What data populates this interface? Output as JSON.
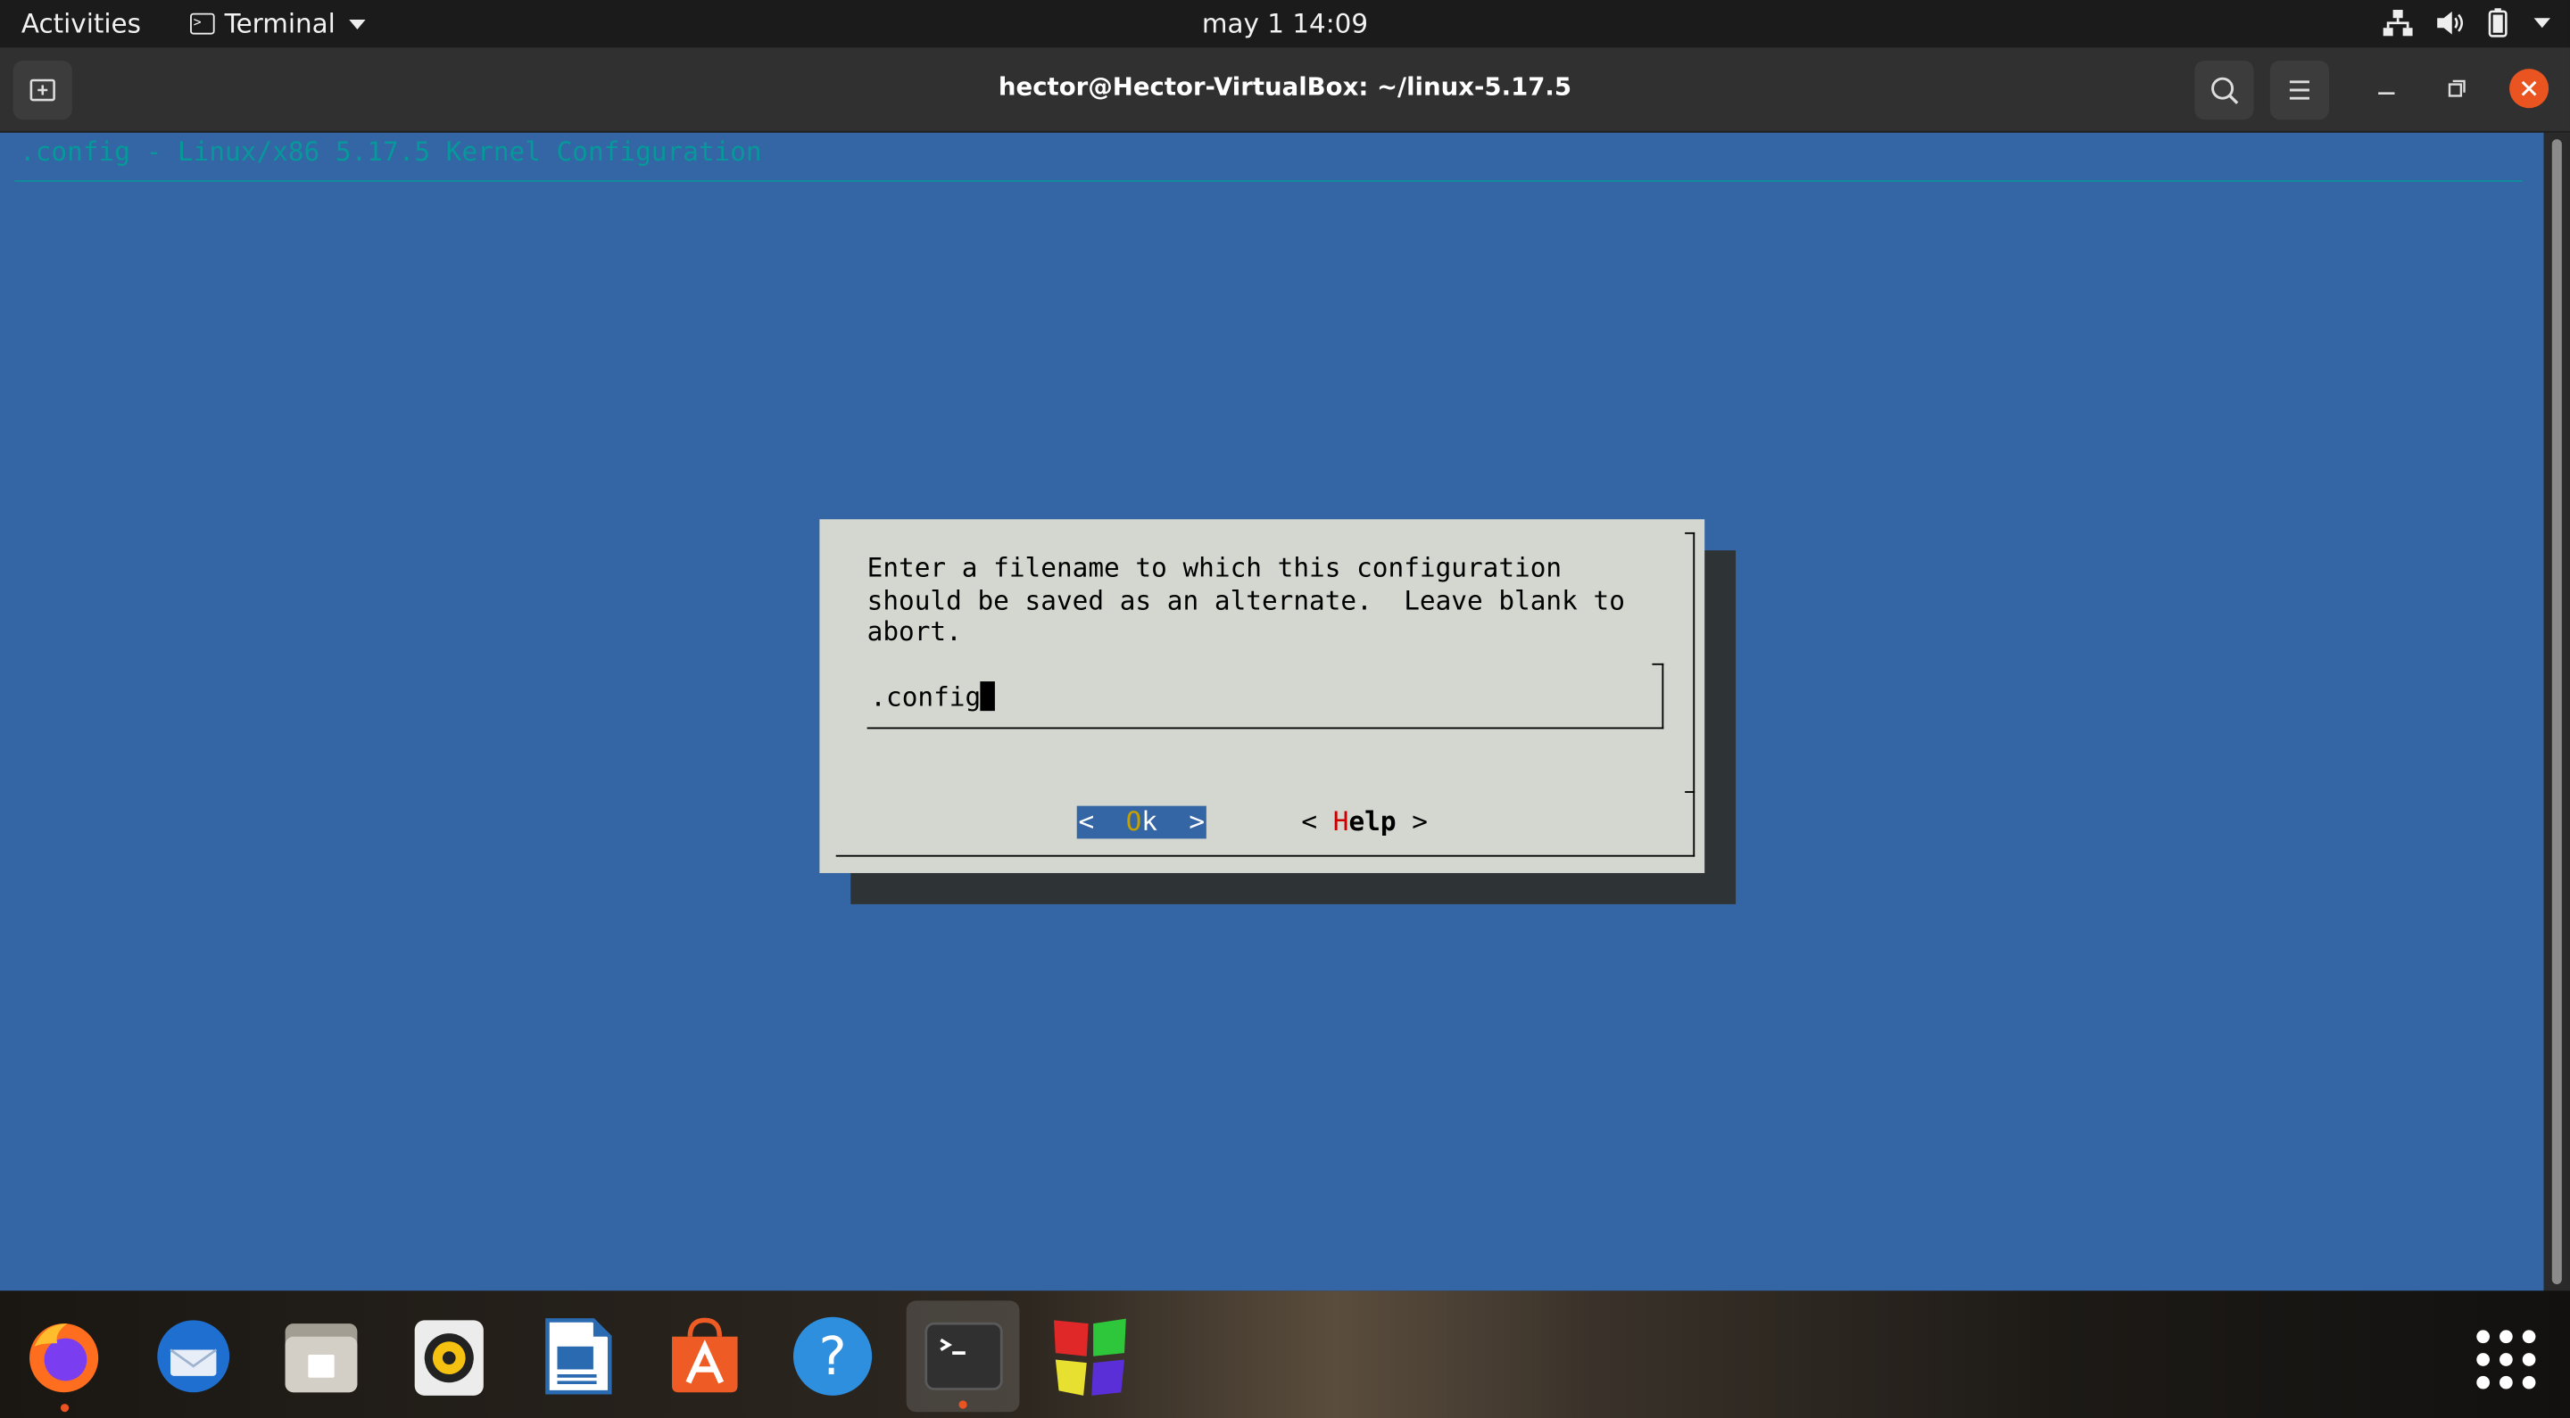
{
  "topbar": {
    "activities": "Activities",
    "app_name": "Terminal",
    "clock": "may 1  14:09",
    "icons": [
      "network-icon",
      "volume-icon",
      "battery-icon",
      "system-menu-caret-icon"
    ]
  },
  "window": {
    "title": "hector@Hector-VirtualBox: ~/linux-5.17.5",
    "buttons": [
      "new-tab-icon",
      "search-icon",
      "hamburger-menu-icon",
      "minimize-icon",
      "maximize-icon",
      "close-icon"
    ]
  },
  "menuconfig": {
    "title": ".config - Linux/x86 5.17.5 Kernel Configuration",
    "dialog": {
      "prompt": "Enter a filename to which this configuration\nshould be saved as an alternate.  Leave blank to\nabort.",
      "input_value": ".config",
      "ok": {
        "left": "<  ",
        "hot": "O",
        "rest": "k",
        "right": "  >"
      },
      "help": {
        "left": "< ",
        "hot": "H",
        "rest": "elp",
        "right": " >"
      }
    }
  },
  "colors": {
    "terminal_bg": "#3465a4",
    "dialog_bg": "#d3d7cf",
    "title_cyan": "#06989a",
    "accent_orange": "#e95420"
  },
  "dock": {
    "items": [
      "firefox-icon",
      "thunderbird-icon",
      "files-icon",
      "rhythmbox-icon",
      "libreoffice-writer-icon",
      "app-center-icon",
      "help-icon",
      "terminal-icon",
      "virtualbox-guest-icon",
      "show-apps-icon"
    ]
  }
}
